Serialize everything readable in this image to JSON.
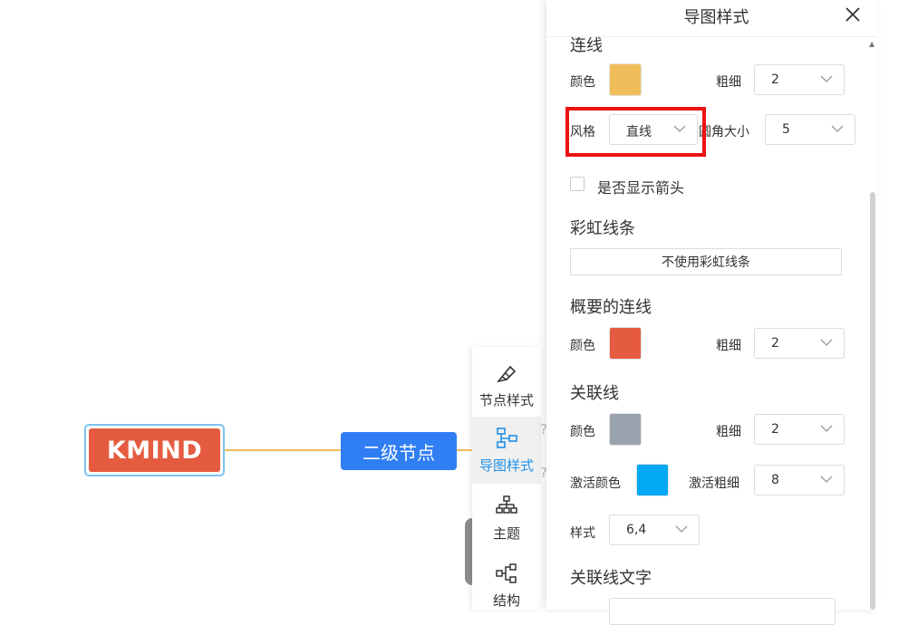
{
  "canvas": {
    "root_node_label": "KMIND",
    "second_node_label": "二级节点",
    "peek_text_1": "?",
    "peek_text_2": "?"
  },
  "toolbar": {
    "items": [
      {
        "label": "节点样式",
        "icon": "brush-icon"
      },
      {
        "label": "导图样式",
        "icon": "map-style-icon"
      },
      {
        "label": "主题",
        "icon": "theme-icon"
      },
      {
        "label": "结构",
        "icon": "structure-icon"
      }
    ],
    "active_index": 1
  },
  "panel": {
    "title": "导图样式",
    "line_section": {
      "title": "连线",
      "color_label": "颜色",
      "color": "#f0bd5b",
      "thickness_label": "粗细",
      "thickness_value": "2",
      "style_label": "风格",
      "style_value": "直线",
      "radius_label": "圆角大小",
      "radius_value": "5",
      "show_arrow_label": "是否显示箭头"
    },
    "rainbow_section": {
      "title": "彩虹线条",
      "button_label": "不使用彩虹线条"
    },
    "summary_section": {
      "title": "概要的连线",
      "color_label": "颜色",
      "color": "#e45b3f",
      "thickness_label": "粗细",
      "thickness_value": "2"
    },
    "relation_section": {
      "title": "关联线",
      "color_label": "颜色",
      "color": "#9aa3ad",
      "thickness_label": "粗细",
      "thickness_value": "2",
      "active_color_label": "激活颜色",
      "active_color": "#03a9f4",
      "active_thickness_label": "激活粗细",
      "active_thickness_value": "8",
      "style_label": "样式",
      "style_value": "6,4"
    },
    "relation_text_section": {
      "title": "关联线文字"
    }
  },
  "colors": {
    "accent": "#1f8fe6",
    "highlight": "#ee1111"
  }
}
